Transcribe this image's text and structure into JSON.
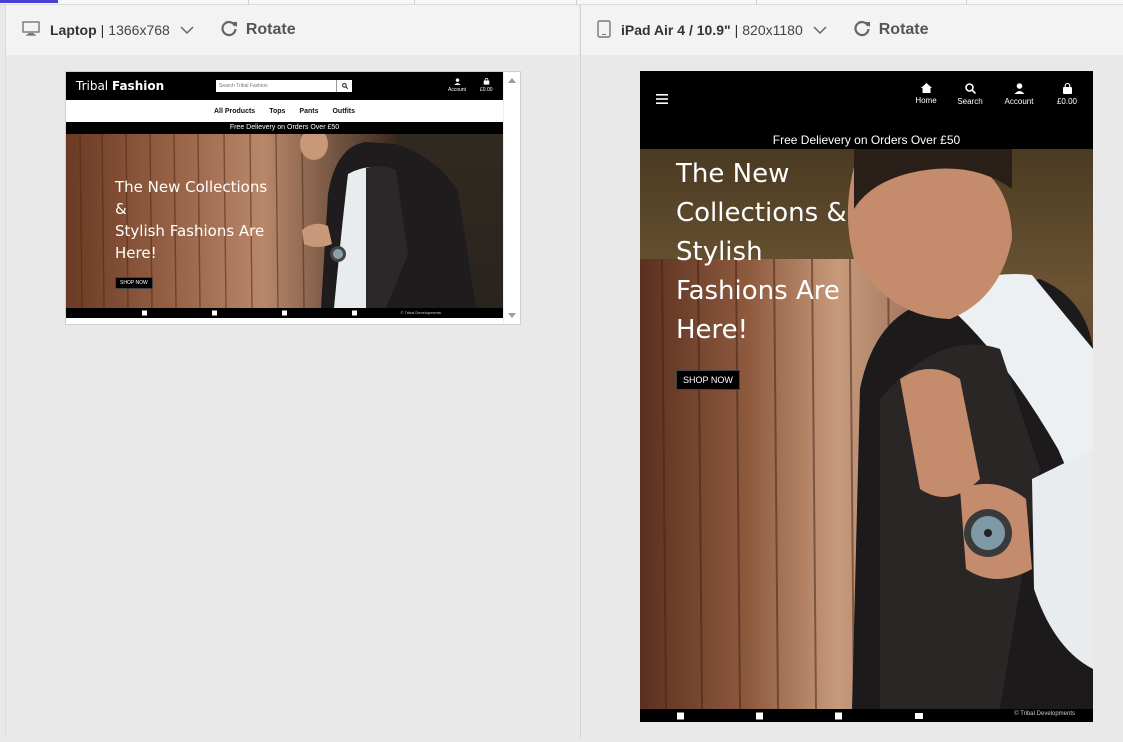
{
  "panels": [
    {
      "device": "Laptop",
      "size": "1366x768",
      "rotate_label": "Rotate"
    },
    {
      "device": "iPad Air 4 / 10.9\"",
      "size": "820x1180",
      "rotate_label": "Rotate"
    }
  ],
  "site": {
    "logo_light": "Tribal ",
    "logo_bold": "Fashion",
    "search_placeholder": "Search Tribal Fashion",
    "account_label": "Account",
    "basket_label": "£0.00",
    "home_label": "Home",
    "search_label": "Search",
    "nav": [
      "All Products",
      "Tops",
      "Pants",
      "Outfits"
    ],
    "banner": "Free Delievery on Orders Over £50",
    "shop_now": "SHOP NOW",
    "copyright": "© Tribal Developments"
  },
  "laptop_hero_lines": [
    "The New Collections",
    "&",
    "Stylish Fashions Are",
    "Here!"
  ],
  "ipad_hero_lines": [
    "The New",
    "Collections &",
    "Stylish",
    "Fashions Are",
    "Here!"
  ],
  "colors": {
    "black": "#000000",
    "frame_bg": "#e9e9e9",
    "toolbar_bg": "#f3f3f3",
    "accent": "#4b3fd6"
  },
  "icons": [
    "desktop-icon",
    "tablet-icon",
    "chevron-down-icon",
    "rotate-icon",
    "user-icon",
    "bag-icon",
    "home-icon",
    "search-icon",
    "menu-icon",
    "facebook-icon",
    "twitter-icon",
    "instagram-icon",
    "youtube-icon"
  ]
}
